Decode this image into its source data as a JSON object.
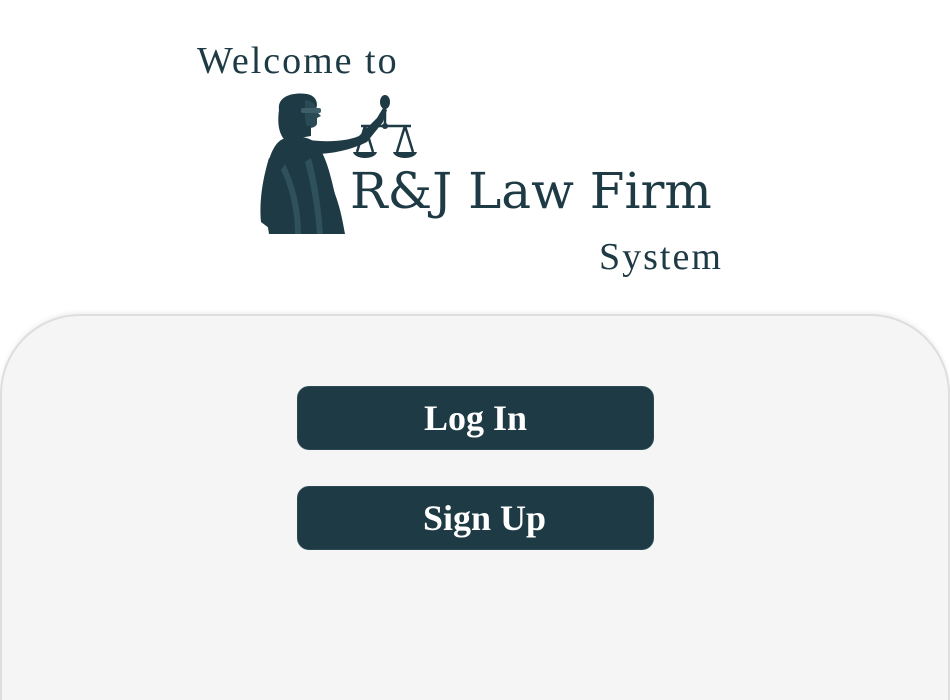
{
  "header": {
    "welcome_text": "Welcome to",
    "firm_name": "R&J Law Firm",
    "system_text": "System",
    "logo_icon": "lady-justice-icon"
  },
  "actions": {
    "login_label": "Log In",
    "signup_label": "Sign Up"
  },
  "colors": {
    "brand": "#1e3a44",
    "panel_bg": "#f5f5f5",
    "button_text": "#ffffff"
  }
}
